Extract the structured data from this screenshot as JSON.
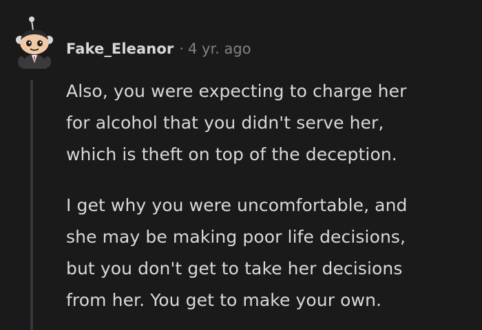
{
  "comment": {
    "username": "Fake_Eleanor",
    "separator": "·",
    "timestamp": "4 yr. ago",
    "avatar_icon": "snoo-avatar-icon",
    "paragraphs": [
      {
        "lines": [
          "Also, you were expecting to charge her",
          "for alcohol that you didn't serve her,",
          "which is theft on top of the deception."
        ]
      },
      {
        "lines": [
          "I get why you were uncomfortable, and",
          "she may be making poor life decisions,",
          "but you don't get to take her decisions",
          "from her. You get to make your own."
        ]
      }
    ]
  },
  "colors": {
    "background": "#1a1a1b",
    "text": "#d7dadc",
    "meta_text": "#818384",
    "thread_line": "#343536"
  }
}
